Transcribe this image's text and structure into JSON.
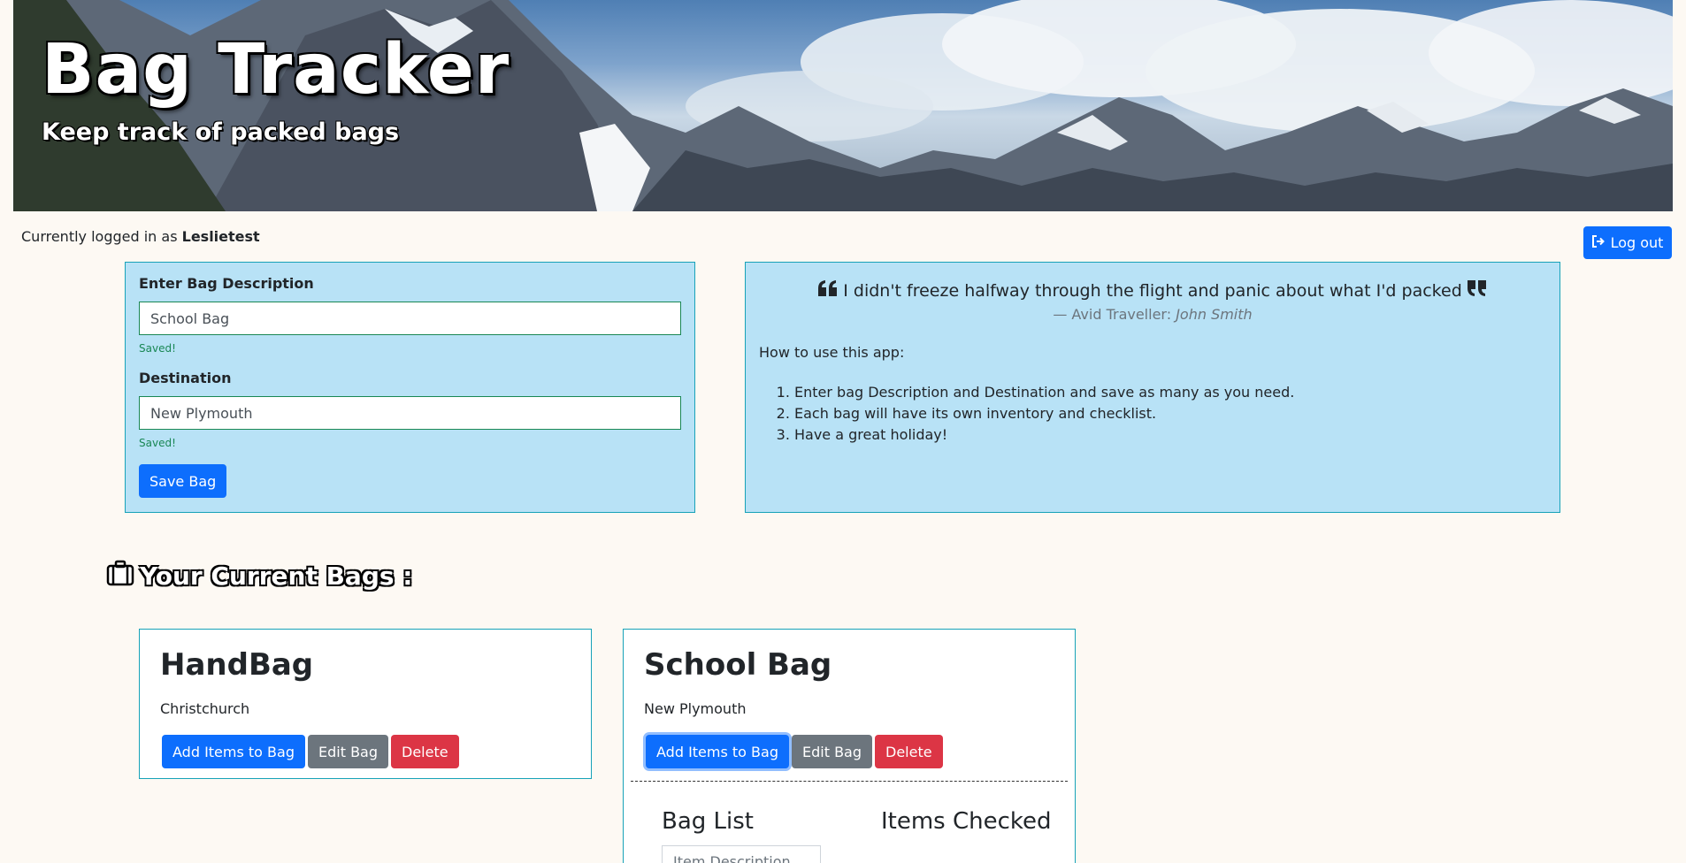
{
  "banner": {
    "title": "Bag Tracker",
    "subtitle": "Keep track of packed bags"
  },
  "session": {
    "prefix": "Currently logged in as ",
    "username": "Leslietest",
    "logout_label": "Log out"
  },
  "form": {
    "description_label": "Enter Bag Description",
    "description_value": "School Bag",
    "description_status": "Saved!",
    "destination_label": "Destination",
    "destination_value": "New Plymouth",
    "destination_status": "Saved!",
    "save_label": "Save Bag"
  },
  "info": {
    "quote": "I didn't freeze halfway through the flight and panic about what I'd packed",
    "author_prefix": "— Avid Traveller: ",
    "author_name": "John Smith",
    "howto_title": "How to use this app:",
    "steps": [
      "Enter bag Description and Destination and save as many as you need.",
      "Each bag will have its own inventory and checklist.",
      "Have a great holiday!"
    ]
  },
  "bags_section": {
    "heading": "Your Current Bags :"
  },
  "bags": [
    {
      "title": "HandBag",
      "destination": "Christchurch",
      "add_label": "Add Items to Bag",
      "edit_label": "Edit Bag",
      "delete_label": "Delete"
    },
    {
      "title": "School Bag",
      "destination": "New Plymouth",
      "add_label": "Add Items to Bag",
      "edit_label": "Edit Bag",
      "delete_label": "Delete",
      "bag_list_title": "Bag List",
      "items_checked_title": "Items Checked",
      "item_placeholder": "Item Description"
    }
  ],
  "colors": {
    "primary": "#0d6efd",
    "secondary": "#6c757d",
    "danger": "#dc3545",
    "success": "#198754",
    "panel_bg": "#b8e2f6",
    "panel_border": "#17a2b8",
    "page_bg": "#fdf9f3"
  },
  "icons": {
    "logout": "sign-out-icon",
    "quote_open": "quote-left-icon",
    "quote_close": "quote-right-icon",
    "suitcase": "suitcase-icon"
  }
}
